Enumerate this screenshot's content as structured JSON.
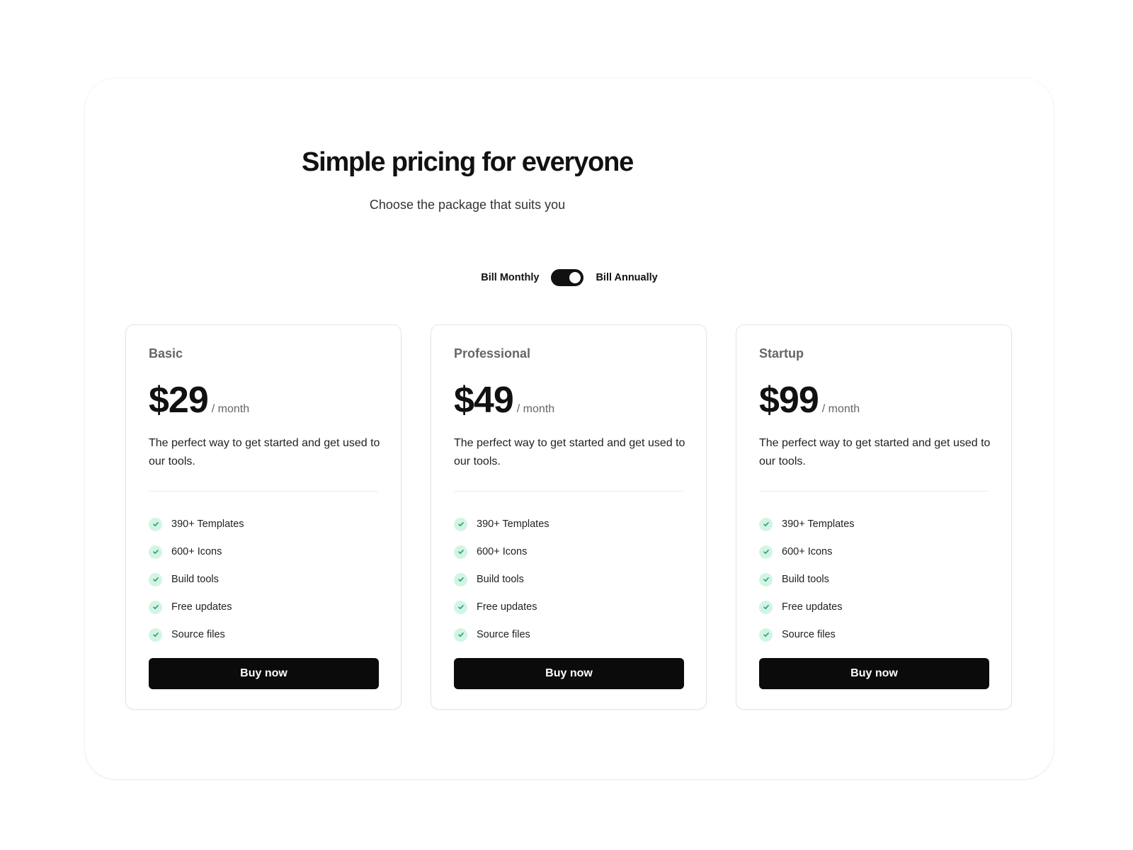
{
  "header": {
    "title": "Simple pricing for everyone",
    "subtitle": "Choose the package that suits you"
  },
  "billing": {
    "monthly_label": "Bill Monthly",
    "annually_label": "Bill Annually",
    "toggle_state": "on"
  },
  "colors": {
    "button_bg": "#0b0b0b",
    "check_bg": "#d3f4e4",
    "check_icon": "#24a36f"
  },
  "plans": [
    {
      "name": "Basic",
      "price": "$29",
      "period": "/ month",
      "description": "The perfect way to get started and get used to our tools.",
      "features": [
        "390+ Templates",
        "600+ Icons",
        "Build tools",
        "Free updates",
        "Source files"
      ],
      "button_label": "Buy now"
    },
    {
      "name": "Professional",
      "price": "$49",
      "period": "/ month",
      "description": "The perfect way to get started and get used to our tools.",
      "features": [
        "390+ Templates",
        "600+ Icons",
        "Build tools",
        "Free updates",
        "Source files"
      ],
      "button_label": "Buy now"
    },
    {
      "name": "Startup",
      "price": "$99",
      "period": "/ month",
      "description": "The perfect way to get started and get used to our tools.",
      "features": [
        "390+ Templates",
        "600+ Icons",
        "Build tools",
        "Free updates",
        "Source files"
      ],
      "button_label": "Buy now"
    }
  ]
}
